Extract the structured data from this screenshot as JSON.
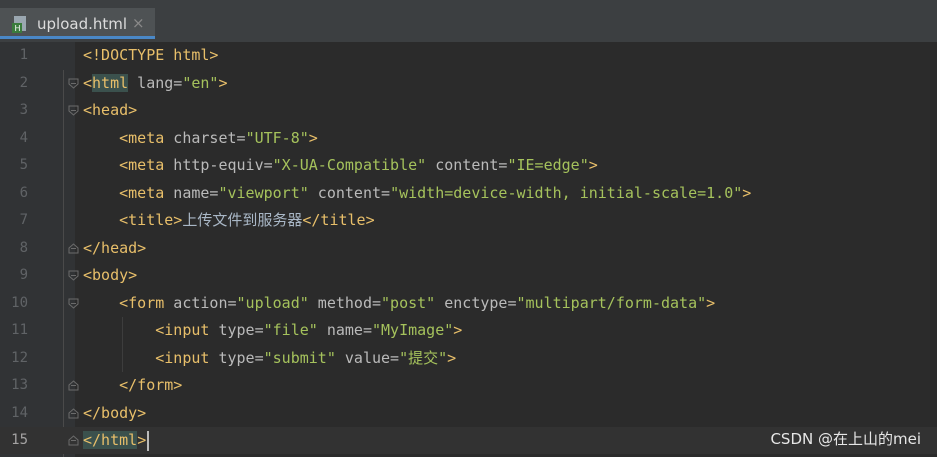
{
  "tab": {
    "title": "upload.html",
    "close": "×",
    "icon": "html-file-icon"
  },
  "colors": {
    "background": "#2b2b2b",
    "gutter": "#313335",
    "tag": "#e8bf6a",
    "attr": "#bababa",
    "value": "#a5c25c",
    "tab_accent": "#4a88c7"
  },
  "editor": {
    "current_line": 15,
    "lines": [
      {
        "n": "1",
        "tokens": [
          [
            "t",
            "<!DOCTYPE html>"
          ]
        ]
      },
      {
        "n": "2",
        "tokens": [
          [
            "t",
            "<"
          ],
          [
            "t hl",
            "html"
          ],
          [
            "a",
            " lang="
          ],
          [
            "v",
            "\"en\""
          ],
          [
            "t",
            ">"
          ]
        ]
      },
      {
        "n": "3",
        "tokens": [
          [
            "t",
            "<head>"
          ]
        ]
      },
      {
        "n": "4",
        "tokens": [
          [
            "txt",
            "    "
          ],
          [
            "t",
            "<meta"
          ],
          [
            "a",
            " charset="
          ],
          [
            "v",
            "\"UTF-8\""
          ],
          [
            "t",
            ">"
          ]
        ]
      },
      {
        "n": "5",
        "tokens": [
          [
            "txt",
            "    "
          ],
          [
            "t",
            "<meta"
          ],
          [
            "a",
            " http-equiv="
          ],
          [
            "v",
            "\"X-UA-Compatible\""
          ],
          [
            "a",
            " content="
          ],
          [
            "v",
            "\"IE=edge\""
          ],
          [
            "t",
            ">"
          ]
        ]
      },
      {
        "n": "6",
        "tokens": [
          [
            "txt",
            "    "
          ],
          [
            "t",
            "<meta"
          ],
          [
            "a",
            " name="
          ],
          [
            "v",
            "\"viewport\""
          ],
          [
            "a",
            " content="
          ],
          [
            "v",
            "\"width=device-width, initial-scale=1.0\""
          ],
          [
            "t",
            ">"
          ]
        ]
      },
      {
        "n": "7",
        "tokens": [
          [
            "txt",
            "    "
          ],
          [
            "t",
            "<title>"
          ],
          [
            "txt",
            "上传文件到服务器"
          ],
          [
            "t",
            "</title>"
          ]
        ]
      },
      {
        "n": "8",
        "tokens": [
          [
            "t",
            "</head>"
          ]
        ]
      },
      {
        "n": "9",
        "tokens": [
          [
            "t",
            "<body>"
          ]
        ]
      },
      {
        "n": "10",
        "tokens": [
          [
            "txt",
            "    "
          ],
          [
            "t",
            "<form"
          ],
          [
            "a",
            " action="
          ],
          [
            "v",
            "\"upload\""
          ],
          [
            "a",
            " method="
          ],
          [
            "v",
            "\"post\""
          ],
          [
            "a",
            " enctype="
          ],
          [
            "v",
            "\"multipart/form-data\""
          ],
          [
            "t",
            ">"
          ]
        ]
      },
      {
        "n": "11",
        "tokens": [
          [
            "txt",
            "        "
          ],
          [
            "t",
            "<input"
          ],
          [
            "a",
            " type="
          ],
          [
            "v",
            "\"file\""
          ],
          [
            "a",
            " name="
          ],
          [
            "v",
            "\"MyImage\""
          ],
          [
            "t",
            ">"
          ]
        ]
      },
      {
        "n": "12",
        "tokens": [
          [
            "txt",
            "        "
          ],
          [
            "t",
            "<input"
          ],
          [
            "a",
            " type="
          ],
          [
            "v",
            "\"submit\""
          ],
          [
            "a",
            " value="
          ],
          [
            "v",
            "\"提交\""
          ],
          [
            "t",
            ">"
          ]
        ]
      },
      {
        "n": "13",
        "tokens": [
          [
            "txt",
            "    "
          ],
          [
            "t",
            "</form>"
          ]
        ]
      },
      {
        "n": "14",
        "tokens": [
          [
            "t",
            "</body>"
          ]
        ]
      },
      {
        "n": "15",
        "tokens": [
          [
            "t hl",
            "</html"
          ],
          [
            "t",
            ">"
          ]
        ]
      }
    ]
  },
  "watermark": "CSDN @在上山的mei"
}
